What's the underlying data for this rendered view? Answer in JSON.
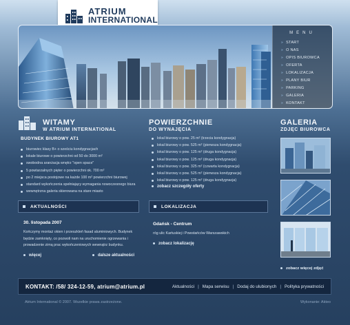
{
  "brand": {
    "line1": "ATRIUM",
    "line2": "INTERNATIONAL"
  },
  "menu": {
    "title": "MENU",
    "items": [
      {
        "label": "START"
      },
      {
        "label": "O NAS"
      },
      {
        "label": "OPIS BIUROWCA"
      },
      {
        "label": "OFERTA"
      },
      {
        "label": "LOKALIZACJA"
      },
      {
        "label": "PLANY BIUR"
      },
      {
        "label": "PARKING"
      },
      {
        "label": "GALERIA"
      },
      {
        "label": "KONTAKT"
      }
    ]
  },
  "welcome": {
    "title": "WITAMY",
    "subtitle": "W ATRIUM INTERNATIONAL",
    "heading": "BUDYNEK BIUROWY AT1",
    "bullets": [
      "biurowiec klasy B+ o sześciu kondygnacjach",
      "lokale biurowe o powierzchni od 50 do 3000 m²",
      "swobodna aranżacja wnętrz \"open space\"",
      "5 powtarzalnych pięter o powierzchni ok. 700 m²",
      "po 2 miejsca postojowe na każde 100 m² powierzchni biurowej",
      "standard wykończenia spełniający wymagania nowoczesnego biura",
      "wewnętrzna galeria skierowana na stare miasto"
    ]
  },
  "offices": {
    "title": "POWIERZCHNIE",
    "subtitle": "DO WYNAJĘCIA",
    "bullets": [
      "lokal biurowy o pow. 25 m² (trzecia kondygnacja)",
      "lokal biurowy o pow. 525 m² (pierwsza kondygnacja)",
      "lokal biurowy o pow. 125 m² (druga kondygnacja)",
      "lokal biurowy o pow. 125 m² (druga kondygnacja)",
      "lokal biurowy o pow. 325 m² (czwarta kondygnacja)",
      "lokal biurowy o pow. 525 m² (pierwsza kondygnacja)",
      "lokal biurowy o pow. 125 m² (druga kondygnacja)"
    ],
    "link": "zobacz szczegóły oferty"
  },
  "gallery": {
    "title": "GALERIA",
    "subtitle": "ZDJĘC BIUROWCA",
    "link": "zobacz więcej zdjęć"
  },
  "news": {
    "bar_label": "AKTUALNOŚCI",
    "date": "30. listopada 2007",
    "text": "Kończymy montaż okien i przeszkleń fasad aluminiowych. Budynek będzie zamknięty, co pozwoli nam na uruchomienie ogrzewania i prowadzenie zimą prac wykończeniowych wewnątrz budynku.",
    "more_link": "więcej",
    "all_link": "dalsze aktualności"
  },
  "location": {
    "bar_label": "LOKALIZACJA",
    "city": "Gdańsk - Centrum",
    "address": "róg ulic Kartuskiej i Powstańców Warszawskich",
    "link": "zobacz lokalizację"
  },
  "footer": {
    "contact": "KONTAKT: /58/ 324-12-59, atrium@atrium.pl",
    "links": [
      "Aktualności",
      "Mapa serwisu",
      "Dodaj do ulubionych",
      "Polityka prywatności"
    ],
    "separator": "|",
    "copyright": "Atrium International © 2007. Wszelkie prawa zastrzeżone.",
    "credit": "Wykonanie: Akteo"
  },
  "colors": {
    "accent": "#1d3352",
    "background_top": "#cfe0ef",
    "background_bottom": "#26405f"
  }
}
